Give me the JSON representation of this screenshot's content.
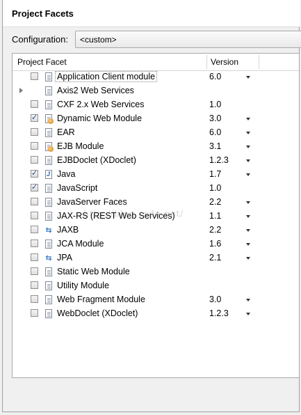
{
  "title": "Project Facets",
  "configuration": {
    "label": "Configuration:",
    "value": "<custom>"
  },
  "table": {
    "headers": {
      "facet": "Project Facet",
      "version": "Version"
    },
    "rows": [
      {
        "name": "Application Client module",
        "version": "6.0",
        "checked": false,
        "dropdown": true,
        "icon": "page-icon",
        "selected": true
      },
      {
        "name": "Axis2 Web Services",
        "version": "",
        "checked": null,
        "dropdown": false,
        "icon": "page-icon",
        "expandable": true
      },
      {
        "name": "CXF 2.x Web Services",
        "version": "1.0",
        "checked": false,
        "dropdown": false,
        "icon": "page-icon"
      },
      {
        "name": "Dynamic Web Module",
        "version": "3.0",
        "checked": true,
        "dropdown": true,
        "icon": "web-module-icon"
      },
      {
        "name": "EAR",
        "version": "6.0",
        "checked": false,
        "dropdown": true,
        "icon": "page-icon"
      },
      {
        "name": "EJB Module",
        "version": "3.1",
        "checked": false,
        "dropdown": true,
        "icon": "ejb-icon"
      },
      {
        "name": "EJBDoclet (XDoclet)",
        "version": "1.2.3",
        "checked": false,
        "dropdown": true,
        "icon": "page-icon"
      },
      {
        "name": "Java",
        "version": "1.7",
        "checked": true,
        "dropdown": true,
        "icon": "java-icon"
      },
      {
        "name": "JavaScript",
        "version": "1.0",
        "checked": true,
        "dropdown": false,
        "icon": "page-icon"
      },
      {
        "name": "JavaServer Faces",
        "version": "2.2",
        "checked": false,
        "dropdown": true,
        "icon": "page-icon"
      },
      {
        "name": "JAX-RS (REST Web Services)",
        "version": "1.1",
        "checked": false,
        "dropdown": true,
        "icon": "page-icon"
      },
      {
        "name": "JAXB",
        "version": "2.2",
        "checked": false,
        "dropdown": true,
        "icon": "arrows-icon"
      },
      {
        "name": "JCA Module",
        "version": "1.6",
        "checked": false,
        "dropdown": true,
        "icon": "page-icon"
      },
      {
        "name": "JPA",
        "version": "2.1",
        "checked": false,
        "dropdown": true,
        "icon": "arrows-icon"
      },
      {
        "name": "Static Web Module",
        "version": "",
        "checked": false,
        "dropdown": false,
        "icon": "page-icon"
      },
      {
        "name": "Utility Module",
        "version": "",
        "checked": false,
        "dropdown": false,
        "icon": "page-icon"
      },
      {
        "name": "Web Fragment Module",
        "version": "3.0",
        "checked": false,
        "dropdown": true,
        "icon": "page-icon"
      },
      {
        "name": "WebDoclet (XDoclet)",
        "version": "1.2.3",
        "checked": false,
        "dropdown": true,
        "icon": "page-icon"
      }
    ]
  },
  "watermark": "http://blog.csdn.net/"
}
